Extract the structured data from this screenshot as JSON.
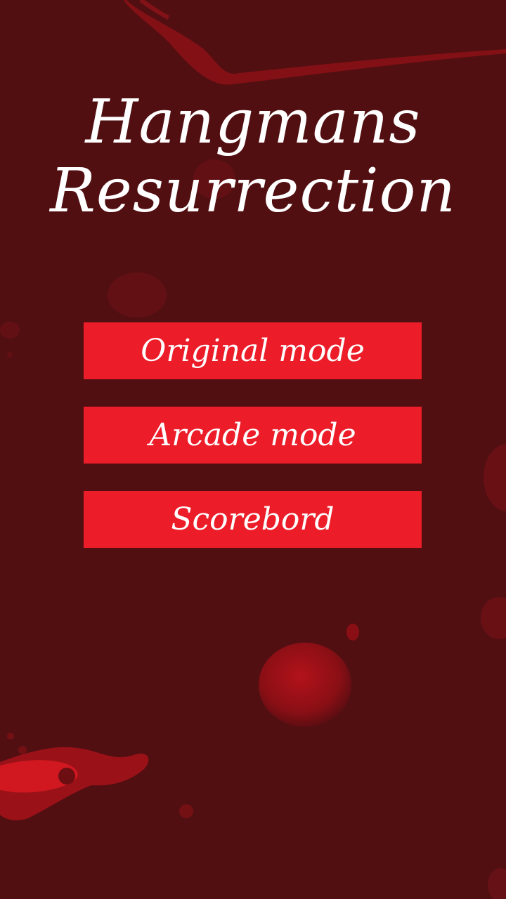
{
  "title": {
    "line1": "Hangmans",
    "line2": "Resurrection"
  },
  "menu": {
    "original_mode": "Original mode",
    "arcade_mode": "Arcade mode",
    "scoreboard": "Scorebord"
  },
  "colors": {
    "background": "#520f12",
    "button": "#ec1c28",
    "text": "#ffffff",
    "blood": "#c4121b"
  }
}
